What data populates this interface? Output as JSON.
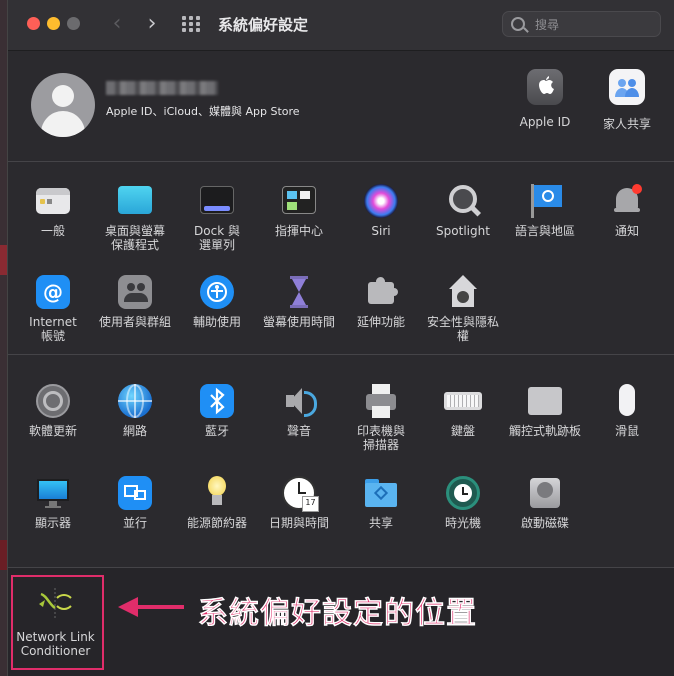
{
  "window": {
    "title": "系統偏好設定",
    "search_placeholder": "搜尋"
  },
  "account": {
    "subtitle": "Apple ID、iCloud、媒體與 App Store",
    "apple_id_label": "Apple ID",
    "family_label": "家人共享"
  },
  "row1": [
    "一般",
    "桌面與螢幕\n保護程式",
    "Dock 與\n選單列",
    "指揮中心",
    "Siri",
    "Spotlight",
    "語言與地區",
    "通知"
  ],
  "row2": [
    "Internet\n帳號",
    "使用者與群組",
    "輔助使用",
    "螢幕使用時間",
    "延伸功能",
    "安全性與隱私權"
  ],
  "row3": [
    "軟體更新",
    "網路",
    "藍牙",
    "聲音",
    "印表機與\n掃描器",
    "鍵盤",
    "觸控式軌跡板",
    "滑鼠"
  ],
  "row4": [
    "顯示器",
    "並行",
    "能源節約器",
    "日期與時間",
    "共享",
    "時光機",
    "啟動磁碟"
  ],
  "other": {
    "nlc_label": "Network Link\nConditioner",
    "annotation": "系統偏好設定的位置"
  },
  "colors": {
    "accent_annotation": "#e02d6a",
    "window_bg": "#2b2a2e"
  }
}
